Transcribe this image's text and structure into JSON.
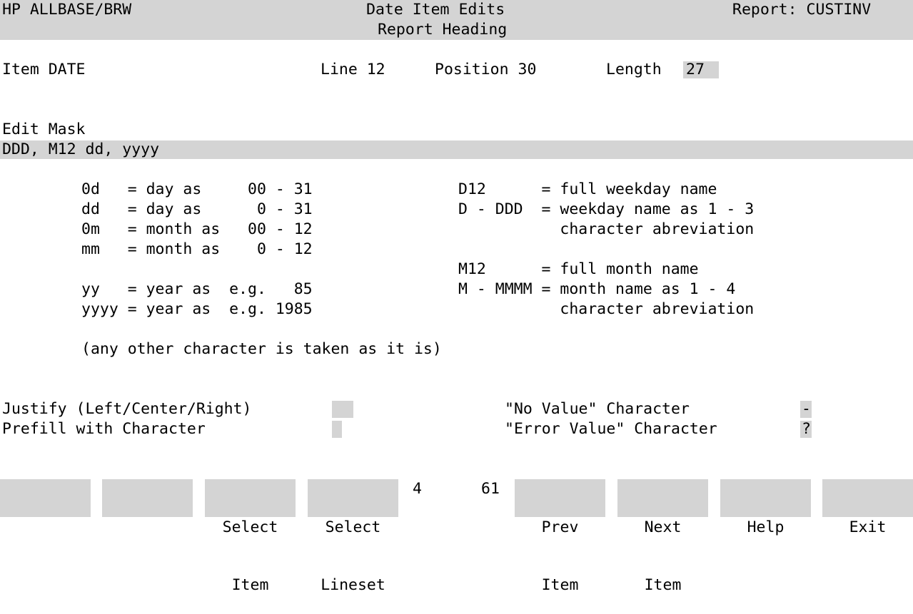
{
  "header": {
    "app": "HP ALLBASE/BRW",
    "title": "Date Item Edits",
    "subtitle": "Report Heading",
    "report_label": "Report: CUSTINV"
  },
  "item": {
    "label": "Item DATE",
    "line": "Line 12",
    "position": "Position 30",
    "length_label": "Length",
    "length_value": "27"
  },
  "edit_mask": {
    "label": "Edit Mask",
    "value": "DDD, M12 dd, yyyy"
  },
  "help_left": [
    "0d   = day as     00 - 31",
    "dd   = day as      0 - 31",
    "0m   = month as   00 - 12",
    "mm   = month as    0 - 12",
    "",
    "yy   = year as  e.g.   85",
    "yyyy = year as  e.g. 1985"
  ],
  "help_right": [
    "D12      = full weekday name",
    "D - DDD  = weekday name as 1 - 3",
    "           character abreviation",
    "",
    "M12      = full month name",
    "M - MMMM = month name as 1 - 4",
    "           character abreviation"
  ],
  "help_note": "(any other character is taken as it is)",
  "options": {
    "justify_label": "Justify (Left/Center/Right)",
    "justify_value": "",
    "prefill_label": "Prefill with Character",
    "prefill_value": "",
    "no_value_label": "\"No Value\" Character",
    "no_value_value": "-",
    "error_value_label": "\"Error Value\" Character",
    "error_value_value": "?"
  },
  "status": {
    "left_number": "4",
    "right_number": "61"
  },
  "function_keys": [
    {
      "line1": "",
      "line2": ""
    },
    {
      "line1": "",
      "line2": ""
    },
    {
      "line1": "Select",
      "line2": "Item"
    },
    {
      "line1": "Select",
      "line2": "Lineset"
    },
    {
      "line1": "Prev",
      "line2": "Item"
    },
    {
      "line1": "Next",
      "line2": "Item"
    },
    {
      "line1": "Help",
      "line2": ""
    },
    {
      "line1": "Exit",
      "line2": ""
    }
  ]
}
